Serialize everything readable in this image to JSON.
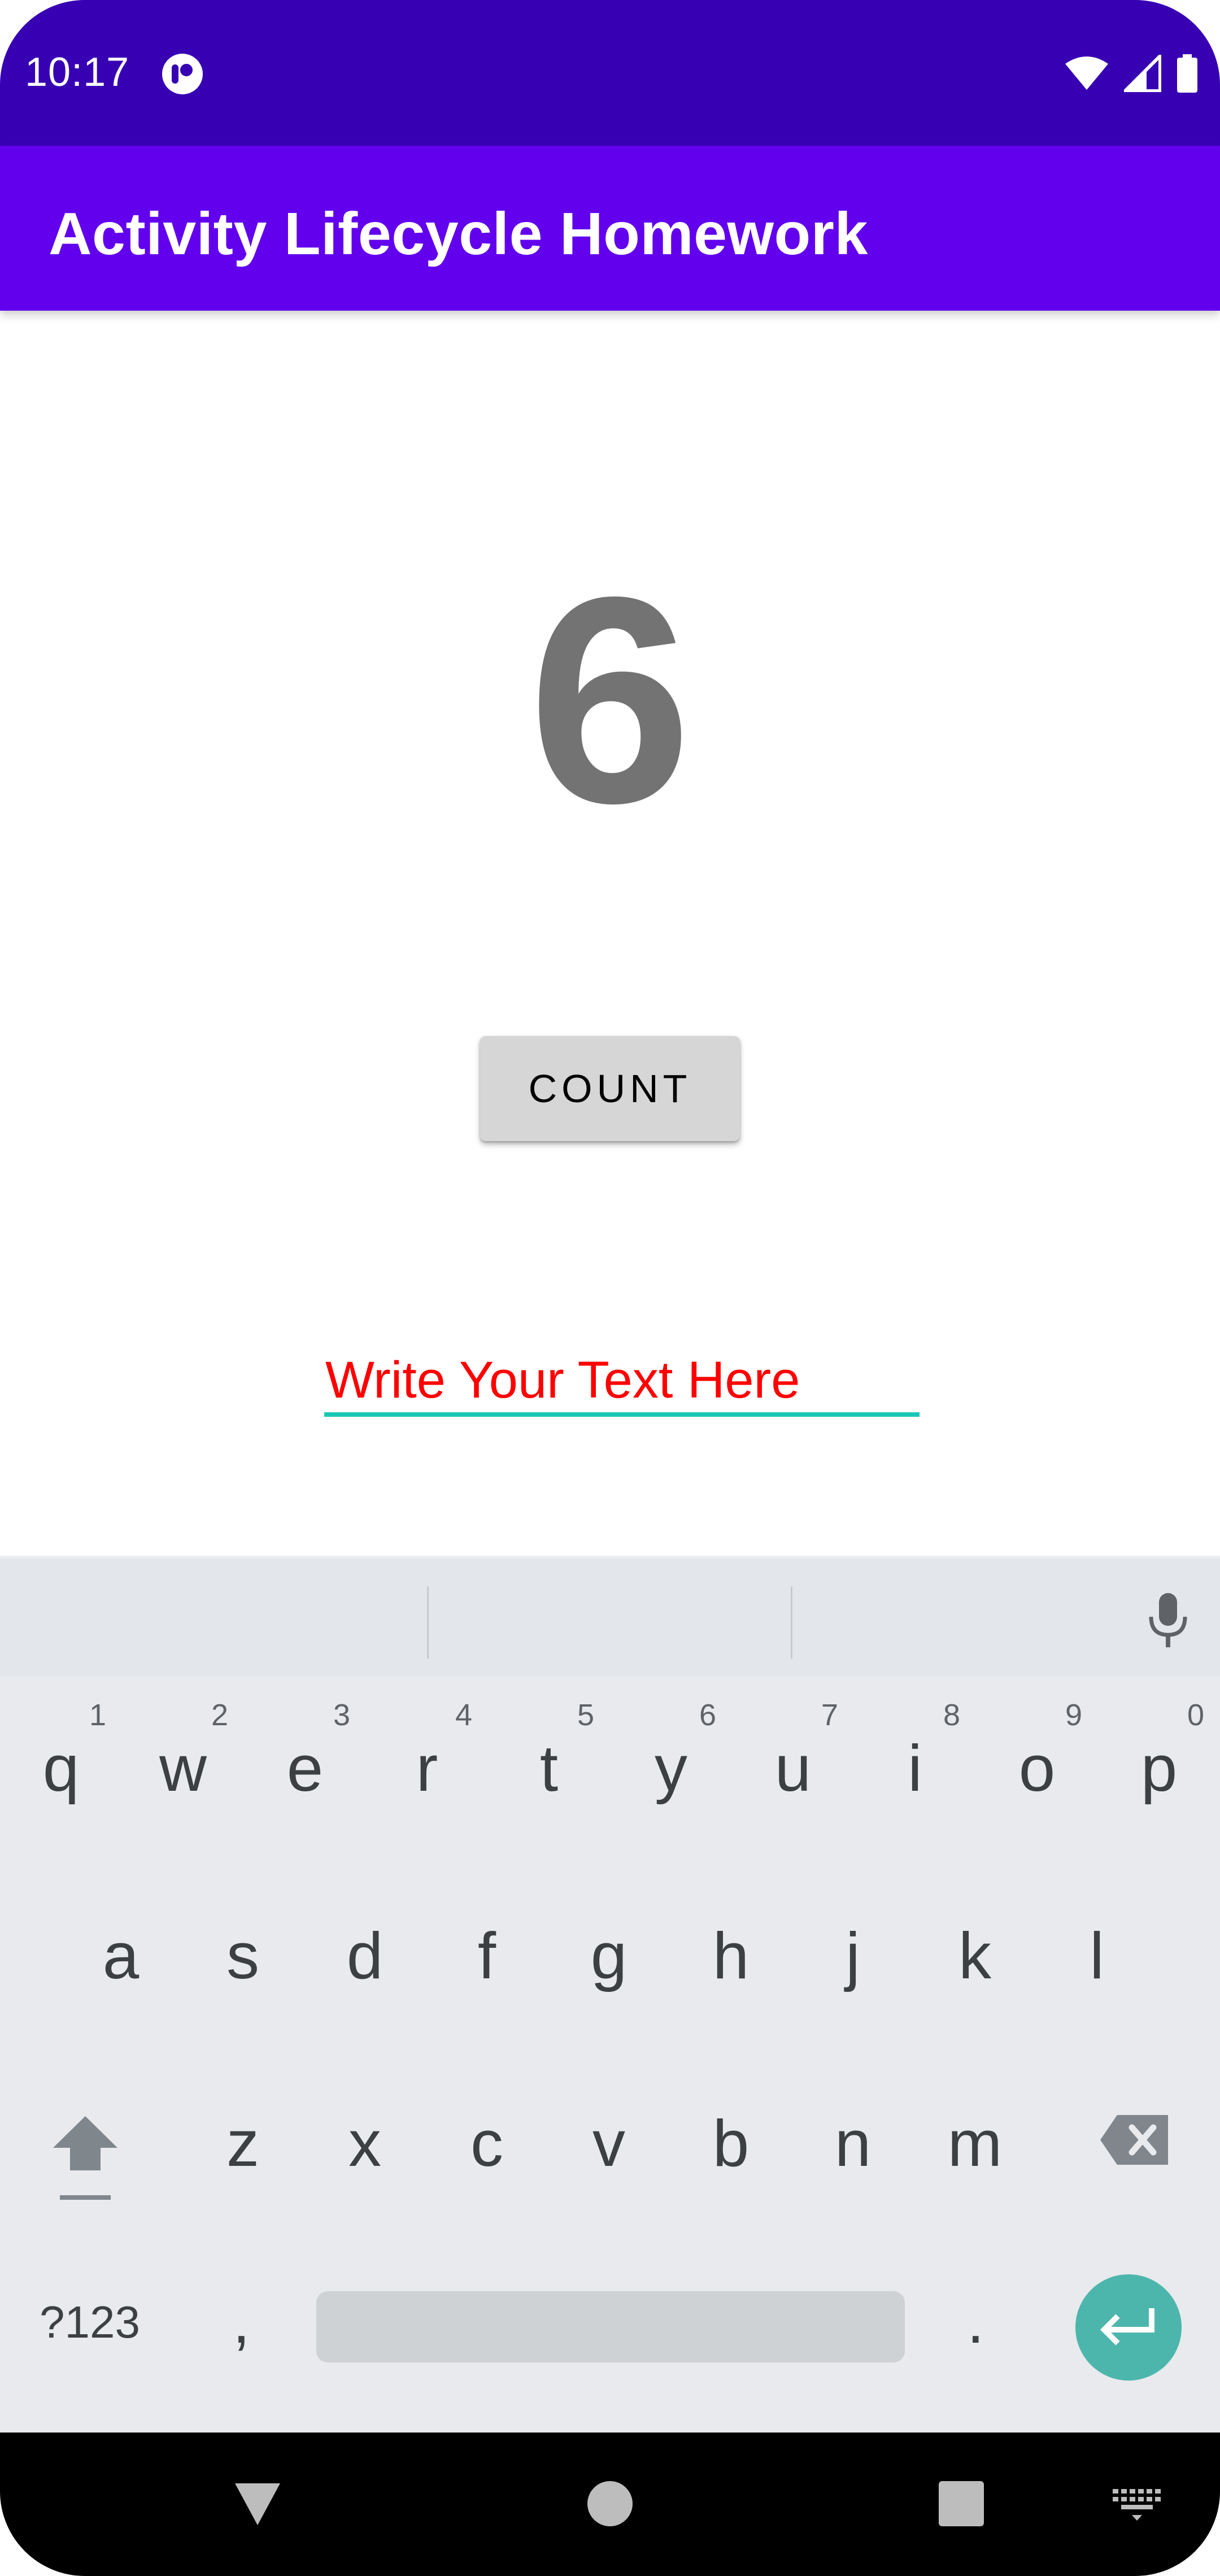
{
  "status_bar": {
    "time": "10:17",
    "icons": [
      "app-notification-icon",
      "wifi-icon",
      "cell-signal-icon",
      "battery-icon"
    ]
  },
  "app_bar": {
    "title": "Activity Lifecycle Homework"
  },
  "content": {
    "count_value": "6",
    "count_button_label": "COUNT",
    "text_field": {
      "value": "",
      "placeholder": "Write Your Text Here"
    }
  },
  "keyboard": {
    "row1": [
      {
        "key": "q",
        "hint": "1"
      },
      {
        "key": "w",
        "hint": "2"
      },
      {
        "key": "e",
        "hint": "3"
      },
      {
        "key": "r",
        "hint": "4"
      },
      {
        "key": "t",
        "hint": "5"
      },
      {
        "key": "y",
        "hint": "6"
      },
      {
        "key": "u",
        "hint": "7"
      },
      {
        "key": "i",
        "hint": "8"
      },
      {
        "key": "o",
        "hint": "9"
      },
      {
        "key": "p",
        "hint": "0"
      }
    ],
    "row2": [
      "a",
      "s",
      "d",
      "f",
      "g",
      "h",
      "j",
      "k",
      "l"
    ],
    "row3": [
      "z",
      "x",
      "c",
      "v",
      "b",
      "n",
      "m"
    ],
    "symbols_label": "?123",
    "comma_label": ",",
    "period_label": "."
  },
  "colors": {
    "status_bar": "#3700B3",
    "app_bar": "#6200EE",
    "hint_text": "#FF0000",
    "field_underline": "#1CC6B5",
    "enter_key": "#4DB6AC"
  }
}
